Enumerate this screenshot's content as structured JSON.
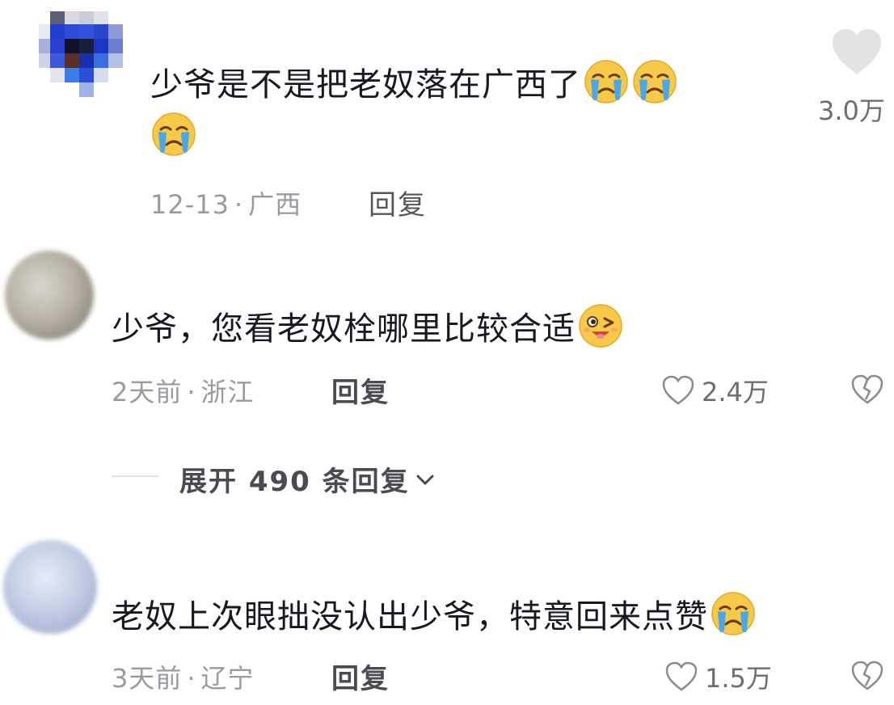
{
  "comments": [
    {
      "text": "少爷是不是把老奴落在广西了",
      "text_line2": "",
      "emojis": [
        "crying-face",
        "crying-face",
        "crying-face"
      ],
      "date": "12-13",
      "location": "广西",
      "reply_label": "回复",
      "likes": "3.0万"
    },
    {
      "text": "少爷，您看老奴栓哪里比较合适",
      "emojis": [
        "winking-face"
      ],
      "date": "2天前",
      "location": "浙江",
      "reply_label": "回复",
      "likes": "2.4万"
    },
    {
      "text": "老奴上次眼拙没认出少爷，特意回来点赞",
      "emojis": [
        "crying-face"
      ],
      "date": "3天前",
      "location": "辽宁",
      "reply_label": "回复",
      "likes": "1.5万"
    }
  ],
  "expand_replies": {
    "label": "展开 490 条回复"
  },
  "separator": "·",
  "colors": {
    "text": "#161823",
    "meta": "#9a9ba1",
    "emoji_face": "#f7c948",
    "tears": "#4aa8e8"
  }
}
